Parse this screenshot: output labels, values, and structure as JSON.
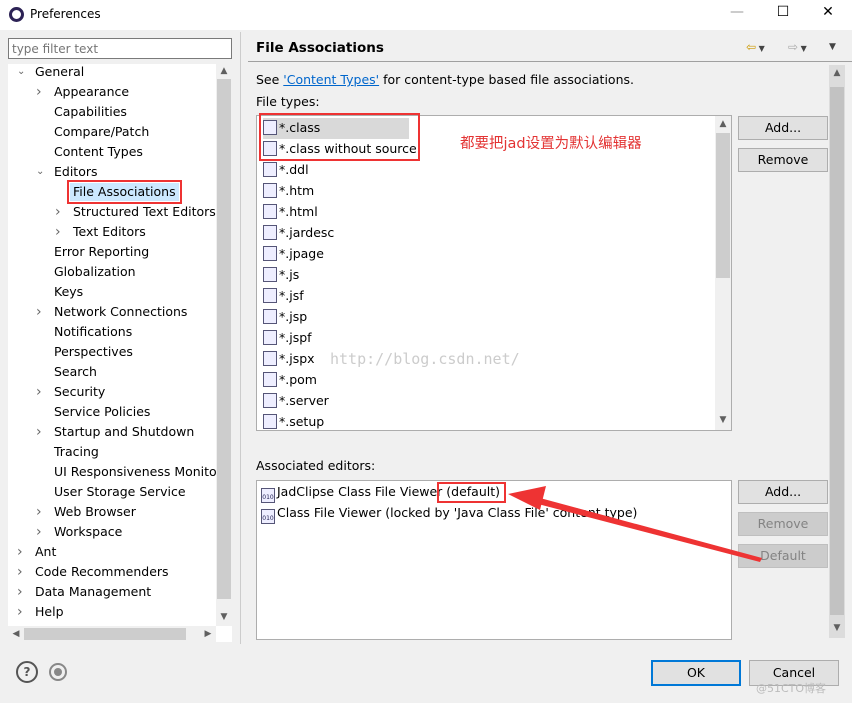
{
  "window": {
    "title": "Preferences",
    "minimize": "—",
    "maximize": "☐",
    "close": "✕"
  },
  "filter": {
    "placeholder": "type filter text"
  },
  "tree": [
    {
      "label": "General",
      "level": 0,
      "arrow": "open"
    },
    {
      "label": "Appearance",
      "level": 1,
      "arrow": "closed"
    },
    {
      "label": "Capabilities",
      "level": 1,
      "arrow": ""
    },
    {
      "label": "Compare/Patch",
      "level": 1,
      "arrow": ""
    },
    {
      "label": "Content Types",
      "level": 1,
      "arrow": ""
    },
    {
      "label": "Editors",
      "level": 1,
      "arrow": "open"
    },
    {
      "label": "File Associations",
      "level": 2,
      "arrow": "",
      "selected": true
    },
    {
      "label": "Structured Text Editors",
      "level": 2,
      "arrow": "closed"
    },
    {
      "label": "Text Editors",
      "level": 2,
      "arrow": "closed"
    },
    {
      "label": "Error Reporting",
      "level": 1,
      "arrow": ""
    },
    {
      "label": "Globalization",
      "level": 1,
      "arrow": ""
    },
    {
      "label": "Keys",
      "level": 1,
      "arrow": ""
    },
    {
      "label": "Network Connections",
      "level": 1,
      "arrow": "closed"
    },
    {
      "label": "Notifications",
      "level": 1,
      "arrow": ""
    },
    {
      "label": "Perspectives",
      "level": 1,
      "arrow": ""
    },
    {
      "label": "Search",
      "level": 1,
      "arrow": ""
    },
    {
      "label": "Security",
      "level": 1,
      "arrow": "closed"
    },
    {
      "label": "Service Policies",
      "level": 1,
      "arrow": ""
    },
    {
      "label": "Startup and Shutdown",
      "level": 1,
      "arrow": "closed"
    },
    {
      "label": "Tracing",
      "level": 1,
      "arrow": ""
    },
    {
      "label": "UI Responsiveness Monitori",
      "level": 1,
      "arrow": ""
    },
    {
      "label": "User Storage Service",
      "level": 1,
      "arrow": ""
    },
    {
      "label": "Web Browser",
      "level": 1,
      "arrow": "closed"
    },
    {
      "label": "Workspace",
      "level": 1,
      "arrow": "closed"
    },
    {
      "label": "Ant",
      "level": 0,
      "arrow": "closed"
    },
    {
      "label": "Code Recommenders",
      "level": 0,
      "arrow": "closed"
    },
    {
      "label": "Data Management",
      "level": 0,
      "arrow": "closed"
    },
    {
      "label": "Help",
      "level": 0,
      "arrow": "closed"
    }
  ],
  "page": {
    "title": "File Associations",
    "intro_pre": "See ",
    "intro_link": "'Content Types'",
    "intro_post": " for content-type based file associations.",
    "file_types_label": "File types:",
    "editors_label": "Associated editors:"
  },
  "file_types": [
    "*.class",
    "*.class without source",
    "*.ddl",
    "*.htm",
    "*.html",
    "*.jardesc",
    "*.jpage",
    "*.js",
    "*.jsf",
    "*.jsp",
    "*.jspf",
    "*.jspx",
    "*.pom",
    "*.server",
    "*.setup"
  ],
  "editors": [
    "JadClipse Class File Viewer (default)",
    "Class File Viewer (locked by 'Java Class File' content type)"
  ],
  "buttons": {
    "add": "Add...",
    "remove": "Remove",
    "add2": "Add...",
    "remove2": "Remove",
    "default": "Default",
    "ok": "OK",
    "cancel": "Cancel"
  },
  "annotation": {
    "text": "都要把jad设置为默认编辑器",
    "color": "#e33333"
  },
  "watermarks": {
    "csdn": "http://blog.csdn.net/",
    "cto": "@51CTO博客"
  }
}
